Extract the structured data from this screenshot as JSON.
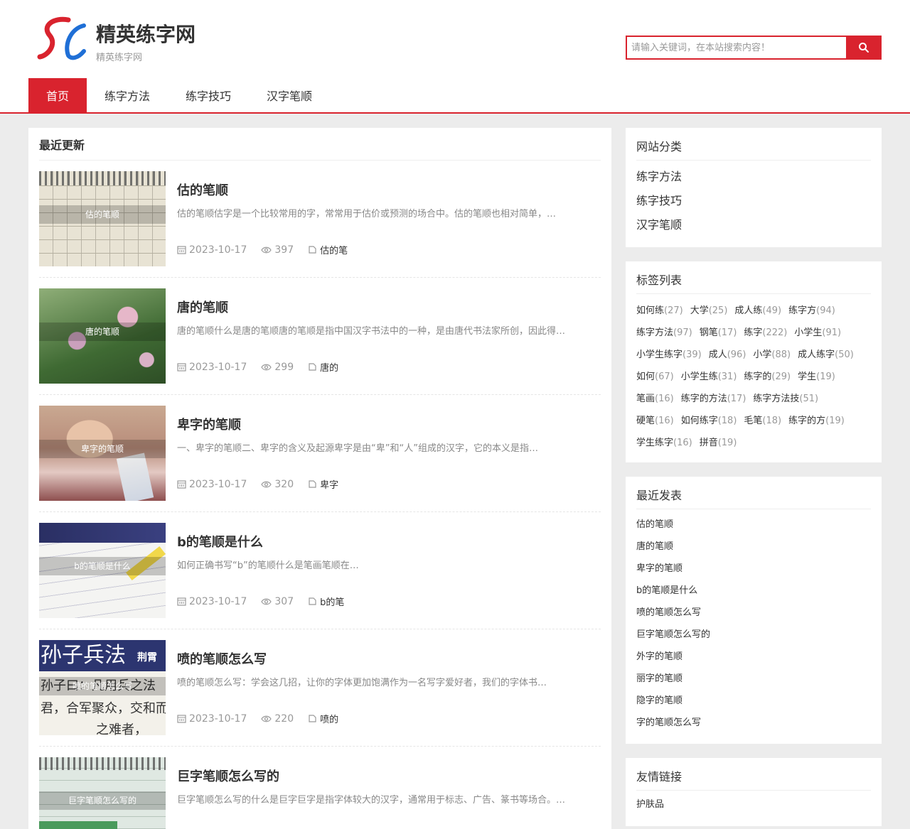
{
  "site": {
    "title": "精英练字网",
    "subtitle": "精英练字网"
  },
  "search": {
    "placeholder": "请输入关键词，在本站搜索内容！"
  },
  "nav": {
    "items": [
      "首页",
      "练字方法",
      "练字技巧",
      "汉字笔顺"
    ]
  },
  "main": {
    "title": "最近更新",
    "posts": [
      {
        "title": "估的笔顺",
        "caption": "估的笔顺",
        "desc": "估的笔顺估字是一个比较常用的字，常常用于估价或预测的场合中。估的笔顺也相对简单，…",
        "date": "2023-10-17",
        "views": "397",
        "tag": "估的笔"
      },
      {
        "title": "唐的笔顺",
        "caption": "唐的笔顺",
        "desc": "唐的笔顺什么是唐的笔顺唐的笔顺是指中国汉字书法中的一种，是由唐代书法家所创，因此得…",
        "date": "2023-10-17",
        "views": "299",
        "tag": "唐的"
      },
      {
        "title": "卑字的笔顺",
        "caption": "卑字的笔顺",
        "desc": "一、卑字的笔顺二、卑字的含义及起源卑字是由“卑”和“人”组成的汉字，它的本义是指…",
        "date": "2023-10-17",
        "views": "320",
        "tag": "卑字"
      },
      {
        "title": "b的笔顺是什么",
        "caption": "b的笔顺是什么",
        "desc": "如何正确书写“b”的笔顺什么是笔画笔顺在…",
        "date": "2023-10-17",
        "views": "307",
        "tag": "b的笔"
      },
      {
        "title": "喷的笔顺怎么写",
        "caption": "喷的笔顺怎么写",
        "desc": "喷的笔顺怎么写：学会这几招，让你的字体更加饱满作为一名写字爱好者，我们的字体书…",
        "date": "2023-10-17",
        "views": "220",
        "tag": "喷的"
      },
      {
        "title": "巨字笔顺怎么写的",
        "caption": "巨字笔顺怎么写的",
        "desc": "巨字笔顺怎么写的什么是巨字巨字是指字体较大的汉字，通常用于标志、广告、篆书等场合。…",
        "date": "",
        "views": "",
        "tag": ""
      }
    ]
  },
  "thumb_texts": {
    "t5_top": "孙子兵法",
    "t5_side": "荆霄",
    "t5_line2": "孙子曰：凡用兵之法",
    "t5_line3": "君，合军聚众，交和而",
    "t5_line4": "之难者，"
  },
  "sidebar": {
    "categories": {
      "title": "网站分类",
      "items": [
        "练字方法",
        "练字技巧",
        "汉字笔顺"
      ]
    },
    "tags": {
      "title": "标签列表",
      "items": [
        {
          "name": "如何练",
          "count": "(27)"
        },
        {
          "name": "大学",
          "count": "(25)"
        },
        {
          "name": "成人练",
          "count": "(49)"
        },
        {
          "name": "练字方",
          "count": "(94)"
        },
        {
          "name": "练字方法",
          "count": "(97)"
        },
        {
          "name": "钢笔",
          "count": "(17)"
        },
        {
          "name": "练字",
          "count": "(222)"
        },
        {
          "name": "小学生",
          "count": "(91)"
        },
        {
          "name": "小学生练字",
          "count": "(39)"
        },
        {
          "name": "成人",
          "count": "(96)"
        },
        {
          "name": "小学",
          "count": "(88)"
        },
        {
          "name": "成人练字",
          "count": "(50)"
        },
        {
          "name": "如何",
          "count": "(67)"
        },
        {
          "name": "小学生练",
          "count": "(31)"
        },
        {
          "name": "练字的",
          "count": "(29)"
        },
        {
          "name": "学生",
          "count": "(19)"
        },
        {
          "name": "笔画",
          "count": "(16)"
        },
        {
          "name": "练字的方法",
          "count": "(17)"
        },
        {
          "name": "练字方法技",
          "count": "(51)"
        },
        {
          "name": "硬笔",
          "count": "(16)"
        },
        {
          "name": "如何练字",
          "count": "(18)"
        },
        {
          "name": "毛笔",
          "count": "(18)"
        },
        {
          "name": "练字的方",
          "count": "(19)"
        },
        {
          "name": "学生练字",
          "count": "(16)"
        },
        {
          "name": "拼音",
          "count": "(19)"
        }
      ]
    },
    "recent": {
      "title": "最近发表",
      "items": [
        "估的笔顺",
        "唐的笔顺",
        "卑字的笔顺",
        "b的笔顺是什么",
        "喷的笔顺怎么写",
        "巨字笔顺怎么写的",
        "外字的笔顺",
        "丽字的笔顺",
        "隐字的笔顺",
        "字的笔顺怎么写"
      ]
    },
    "friends": {
      "title": "友情链接",
      "items": [
        "护肤品"
      ]
    }
  },
  "colors": {
    "accent": "#d9232e",
    "logo_blue": "#1f6fd6"
  }
}
